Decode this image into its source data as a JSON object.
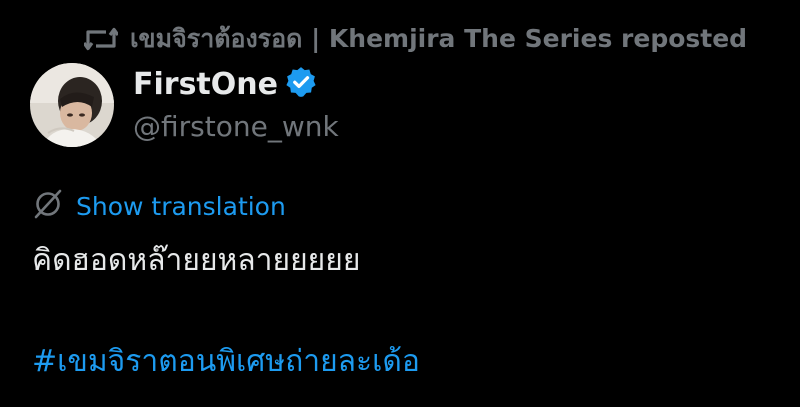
{
  "repost": {
    "icon": "repost-icon",
    "text": "เขมจิราต้องรอด | Khemjira The Series reposted"
  },
  "author": {
    "display_name": "FirstOne",
    "verified_icon": "verified-badge-icon",
    "handle": "@firstone_wnk",
    "avatar": "profile-photo"
  },
  "translation": {
    "icon": "translate-globe-icon",
    "label": "Show translation"
  },
  "post": {
    "text": "คิดฮอดหล๊ายยหลายยยยย",
    "hashtag": "#เขมจิราตอนพิเศษถ่ายละเด้อ"
  },
  "colors": {
    "background": "#000000",
    "primary_text": "#e7e9ea",
    "secondary_text": "#71767b",
    "accent": "#1d9bf0"
  }
}
